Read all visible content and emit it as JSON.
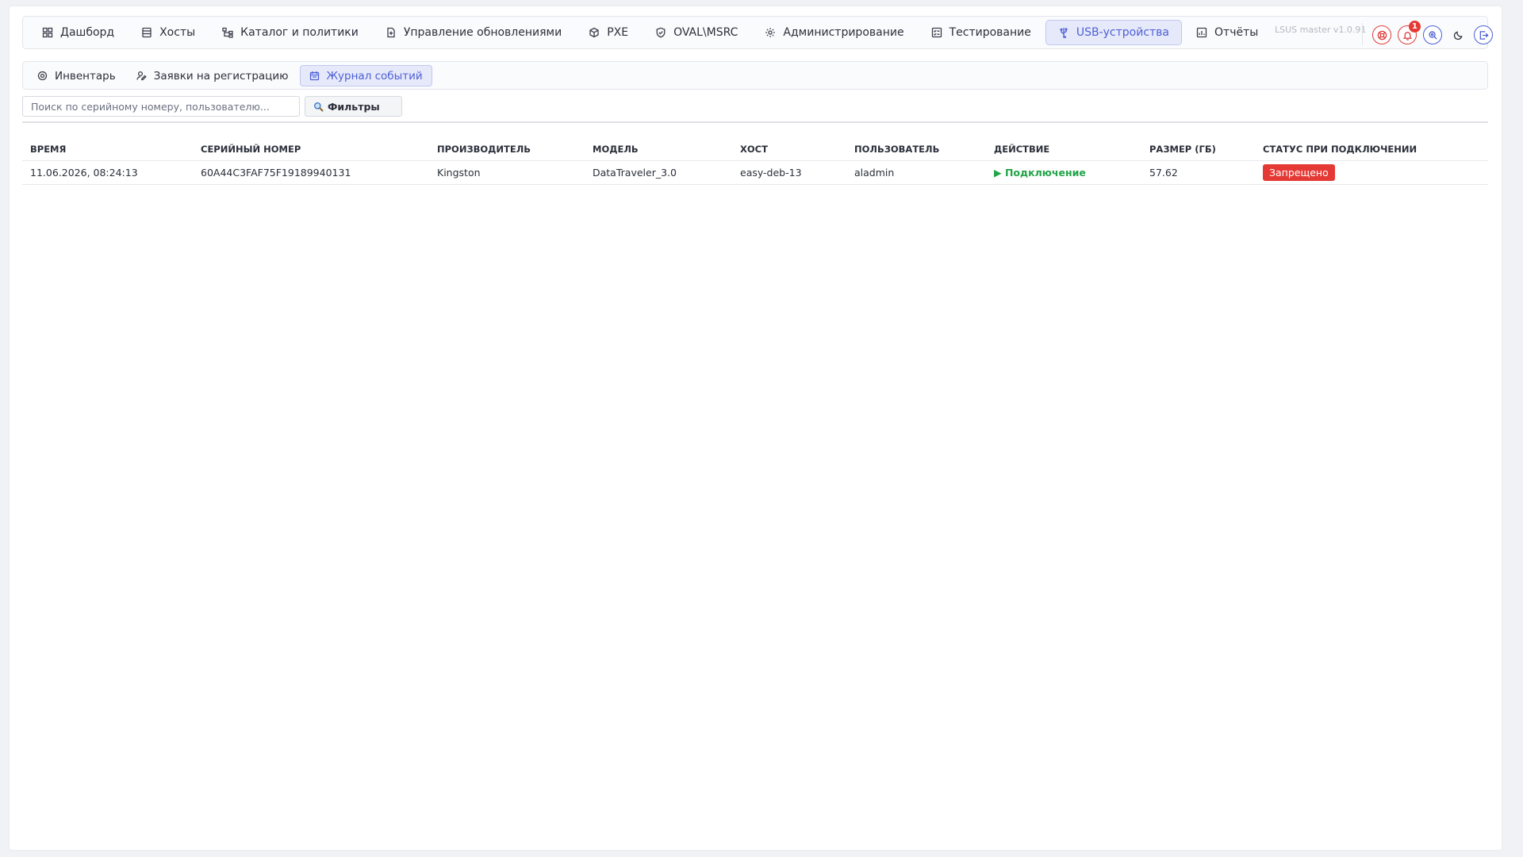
{
  "nav": {
    "items": [
      {
        "label": "Дашборд",
        "icon": "dashboard-icon",
        "active": false
      },
      {
        "label": "Хосты",
        "icon": "server-icon",
        "active": false
      },
      {
        "label": "Каталог и политики",
        "icon": "sitemap-icon",
        "active": false
      },
      {
        "label": "Управление обновлениями",
        "icon": "file-plus-icon",
        "active": false
      },
      {
        "label": "PXE",
        "icon": "cube-icon",
        "active": false
      },
      {
        "label": "OVAL\\MSRC",
        "icon": "shield-icon",
        "active": false
      },
      {
        "label": "Администрирование",
        "icon": "cog-icon",
        "active": false
      },
      {
        "label": "Тестирование",
        "icon": "checklist-icon",
        "active": false
      },
      {
        "label": "USB-устройства",
        "icon": "usb-icon",
        "active": true
      },
      {
        "label": "Отчёты",
        "icon": "report-icon",
        "active": false
      }
    ],
    "version": "LSUS master v1.0.91",
    "notification_count": "1"
  },
  "subnav": {
    "items": [
      {
        "label": "Инвентарь",
        "icon": "inventory-icon",
        "active": false
      },
      {
        "label": "Заявки на регистрацию",
        "icon": "user-edit-icon",
        "active": false
      },
      {
        "label": "Журнал событий",
        "icon": "calendar-icon",
        "active": true
      }
    ]
  },
  "search": {
    "placeholder": "Поиск по серийному номеру, пользователю...",
    "value": ""
  },
  "filters": {
    "label": "Фильтры",
    "icon": "magnifier-icon"
  },
  "table": {
    "columns": [
      "ВРЕМЯ",
      "СЕРИЙНЫЙ НОМЕР",
      "ПРОИЗВОДИТЕЛЬ",
      "МОДЕЛЬ",
      "ХОСТ",
      "ПОЛЬЗОВАТЕЛЬ",
      "ДЕЙСТВИЕ",
      "РАЗМЕР (ГБ)",
      "СТАТУС ПРИ ПОДКЛЮЧЕНИИ"
    ],
    "rows": [
      {
        "time": "11.06.2026, 08:24:13",
        "serial": "60A44C3FAF75F19189940131",
        "vendor": "Kingston",
        "model": "DataTraveler_3.0",
        "host": "easy-deb-13",
        "user": "aladmin",
        "action": "▶ Подключение",
        "size": "57.62",
        "status": "Запрещено"
      }
    ]
  },
  "colors": {
    "accent": "#4c5fd5",
    "action_connect": "#22a447",
    "status_denied": "#e53935"
  }
}
